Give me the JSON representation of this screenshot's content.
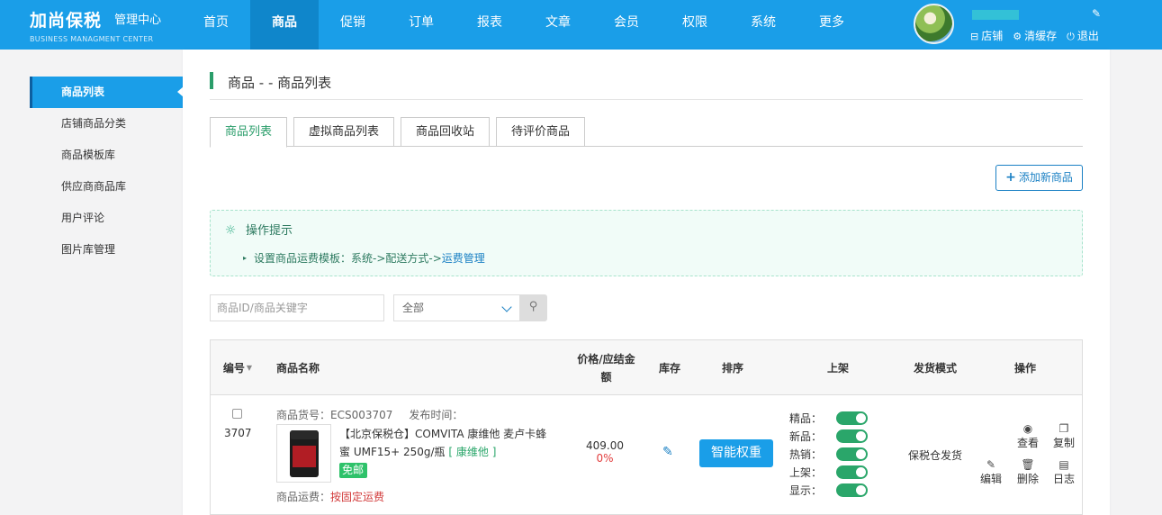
{
  "brand": {
    "name": "加尚保税",
    "sub": "管理中心",
    "en": "BUSINESS MANAGMENT CENTER"
  },
  "nav": [
    "首页",
    "商品",
    "促销",
    "订单",
    "报表",
    "文章",
    "会员",
    "权限",
    "系统",
    "更多"
  ],
  "header_links": {
    "shop": "店铺",
    "cache": "清缓存",
    "logout": "退出"
  },
  "sidebar": [
    "商品列表",
    "店铺商品分类",
    "商品模板库",
    "供应商商品库",
    "用户评论",
    "图片库管理"
  ],
  "page_title": "商品 - - 商品列表",
  "tabs": [
    "商品列表",
    "虚拟商品列表",
    "商品回收站",
    "待评价商品"
  ],
  "add_button": "添加新商品",
  "tips": {
    "title": "操作提示",
    "line_prefix": "设置商品运费模板：系统->配送方式->",
    "line_link": "运费管理"
  },
  "search": {
    "placeholder": "商品ID/商品关键字",
    "select_value": "全部"
  },
  "table": {
    "headers": {
      "id": "编号",
      "name": "商品名称",
      "price": "价格/应结金额",
      "stock": "库存",
      "sort": "排序",
      "onsale": "上架",
      "ship_mode": "发货模式",
      "actions": "操作"
    },
    "rows": [
      {
        "id": "3707",
        "sku_label": "商品货号：ECS003707",
        "publish_label": "发布时间：",
        "title": "【北京保税仓】COMVITA 康维他 麦卢卡蜂蜜 UMF15+ 250g/瓶",
        "brand": "[ 康维他 ]",
        "free_tag": "免邮",
        "ship_label": "商品运费：",
        "ship_value": "按固定运费",
        "price": "409.00",
        "rate": "0%",
        "sort_button": "智能权重",
        "toggles": [
          "精品：",
          "新品：",
          "热销：",
          "上架：",
          "显示："
        ],
        "ship_mode": "保税仓发货",
        "actions": {
          "view": "查看",
          "copy": "复制",
          "edit": "编辑",
          "delete": "删除",
          "log": "日志"
        }
      }
    ]
  },
  "icons": [
    "edit-icon",
    "shop-icon",
    "gear-icon",
    "power-icon",
    "bulb-icon",
    "search-icon",
    "chevron-down-icon",
    "eye-icon",
    "copy-icon",
    "trash-icon",
    "log-icon"
  ]
}
